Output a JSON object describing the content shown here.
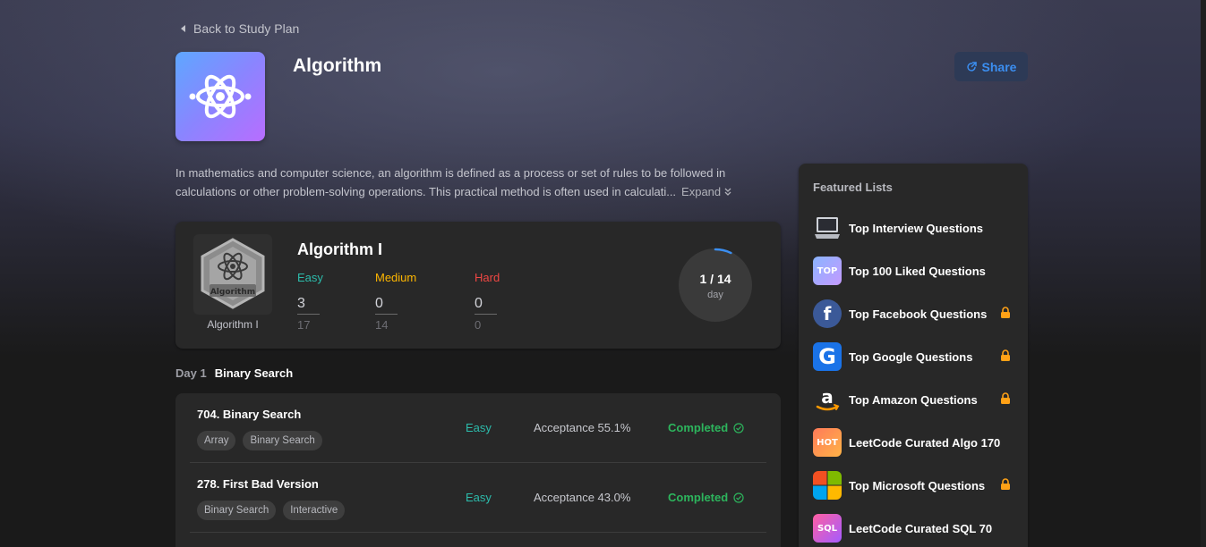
{
  "nav": {
    "back_label": "Back to Study Plan"
  },
  "plan": {
    "title": "Algorithm",
    "share_label": "Share",
    "description": "In mathematics and computer science, an algorithm is defined as a process or set of rules to be followed in calculations or other problem-solving operations. This practical method is often used in calculati...",
    "expand_label": "Expand"
  },
  "card": {
    "badge_text": "Algorithm",
    "badge_caption": "Algorithm I",
    "title": "Algorithm I",
    "easy": {
      "label": "Easy",
      "done": "3",
      "total": "17",
      "color": "#2cbbab"
    },
    "medium": {
      "label": "Medium",
      "done": "0",
      "total": "14",
      "color": "#ffb700"
    },
    "hard": {
      "label": "Hard",
      "done": "0",
      "total": "0",
      "color": "#ef4743"
    },
    "progress": {
      "label": "1 / 14",
      "sub": "day",
      "fraction": 0.0714
    }
  },
  "day": {
    "label": "Day 1",
    "topic": "Binary Search"
  },
  "questions": [
    {
      "title": "704. Binary Search",
      "tags": [
        "Array",
        "Binary Search"
      ],
      "difficulty": "Easy",
      "acceptance": "Acceptance 55.1%",
      "status": "Completed"
    },
    {
      "title": "278. First Bad Version",
      "tags": [
        "Binary Search",
        "Interactive"
      ],
      "difficulty": "Easy",
      "acceptance": "Acceptance 43.0%",
      "status": "Completed"
    }
  ],
  "featured": {
    "title": "Featured Lists",
    "items": [
      {
        "label": "Top Interview Questions",
        "icon": "laptop-icon",
        "locked": false
      },
      {
        "label": "Top 100 Liked Questions",
        "icon": "top-icon",
        "locked": false
      },
      {
        "label": "Top Facebook Questions",
        "icon": "facebook-icon",
        "locked": true
      },
      {
        "label": "Top Google Questions",
        "icon": "google-icon",
        "locked": true
      },
      {
        "label": "Top Amazon Questions",
        "icon": "amazon-icon",
        "locked": true
      },
      {
        "label": "LeetCode Curated Algo 170",
        "icon": "hot-icon",
        "locked": false
      },
      {
        "label": "Top Microsoft Questions",
        "icon": "microsoft-icon",
        "locked": true
      },
      {
        "label": "LeetCode Curated SQL 70",
        "icon": "sql-icon",
        "locked": false
      }
    ]
  },
  "colors": {
    "accent": "#3b8ef0",
    "lock": "#ffa116",
    "completed": "#2db55d",
    "easy": "#2cbbab"
  }
}
